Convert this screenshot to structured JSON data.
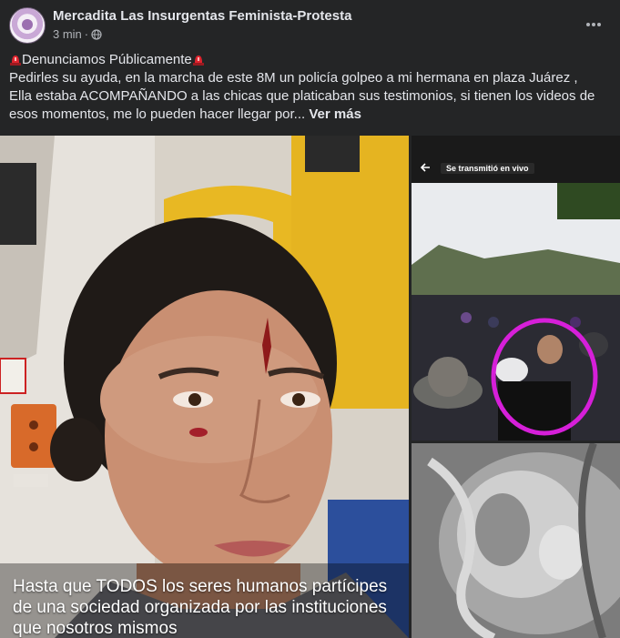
{
  "post": {
    "page_name": "Mercadita Las Insurgentas Feminista-Protesta",
    "timestamp": "3 min",
    "separator": "·",
    "more_icon": "more-horizontal-icon",
    "privacy_icon": "globe-icon",
    "text": {
      "heading": "Denunciamos Públicamente",
      "line1": " Pedirles su ayuda, en la marcha de este 8M un policía golpeo a mi hermana en plaza Juárez ,",
      "line2": " Ella estaba ACOMPAÑANDO a las chicas que platicaban sus testimonios,  si tienen los videos de esos momentos, me lo pueden hacer llegar por... ",
      "see_more": "Ver más"
    }
  },
  "media": {
    "main_photo": {
      "caption": "Hasta que TODOS los seres humanos partícipes de una sociedad organizada por las instituciones que nosotros mismos"
    },
    "top_right_photo": {
      "live_label": "Se transmitió en vivo"
    },
    "bottom_right_photo": {}
  },
  "colors": {
    "background": "#242526",
    "text_primary": "#e4e6eb",
    "text_secondary": "#b0b3b8",
    "siren_red": "#e0242f",
    "highlight_magenta": "#d61fd9"
  }
}
